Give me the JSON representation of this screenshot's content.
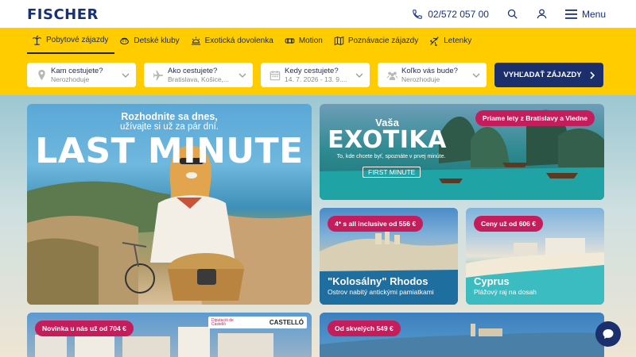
{
  "brand": {
    "logo": "FISCHER",
    "primary": "#17307a",
    "accent": "#ffcc00",
    "badge": "#c51d5c"
  },
  "header": {
    "phone": "02/572 057 00",
    "menu_label": "Menu",
    "icons": [
      "phone-icon",
      "search-icon",
      "user-icon",
      "hamburger-icon"
    ]
  },
  "tabs": [
    {
      "label": "Pobytové zájazdy",
      "icon": "palm-icon",
      "active": true
    },
    {
      "label": "Detské kluby",
      "icon": "kids-icon"
    },
    {
      "label": "Exotická dovolenka",
      "icon": "sun-icon"
    },
    {
      "label": "Motion",
      "icon": "motion-icon"
    },
    {
      "label": "Poznávacie zájazdy",
      "icon": "map-icon"
    },
    {
      "label": "Letenky",
      "icon": "plane-icon"
    }
  ],
  "search": {
    "destination": {
      "label": "Kam cestujete?",
      "value": "Nerozhoduje"
    },
    "transport": {
      "label": "Ako cestujete?",
      "value": "Bratislava, Košice,..."
    },
    "dates": {
      "label": "Kedy cestujete?",
      "value": "14. 7. 2026 - 13. 9...."
    },
    "people": {
      "label": "Koľko vás bude?",
      "value": "Nerozhoduje"
    },
    "submit": "VYHĽADAŤ ZÁJAZDY"
  },
  "promos": {
    "last_minute": {
      "line1": "Rozhodnite sa dnes,",
      "line2": "užívajte si už za pár dní.",
      "title": "LAST MINUTE"
    },
    "exotika": {
      "line1": "Vaša",
      "title": "EXOTIKA",
      "subtitle": "To, kde chcete byť, spoznáte v prvej minúte.",
      "tag": "FIRST MINUTE",
      "badge": "Priame lety z Bratislavy a Viedne"
    },
    "rhodos": {
      "badge": "4* s all inclusive od 556 €",
      "name": "\"Kolosálny\" Rhodos",
      "sub": "Ostrov nabitý antickými pamiatkami"
    },
    "cyprus": {
      "badge": "Ceny už od 606 €",
      "name": "Cyprus",
      "sub": "Plážový raj na dosah"
    },
    "castello": {
      "badge": "Novinka u nás už od 704 €",
      "logo_left": "Diputació de Castelló",
      "logo_right": "CASTELLÓ"
    },
    "bottom_right": {
      "badge": "Od skvelých 549 €"
    }
  }
}
